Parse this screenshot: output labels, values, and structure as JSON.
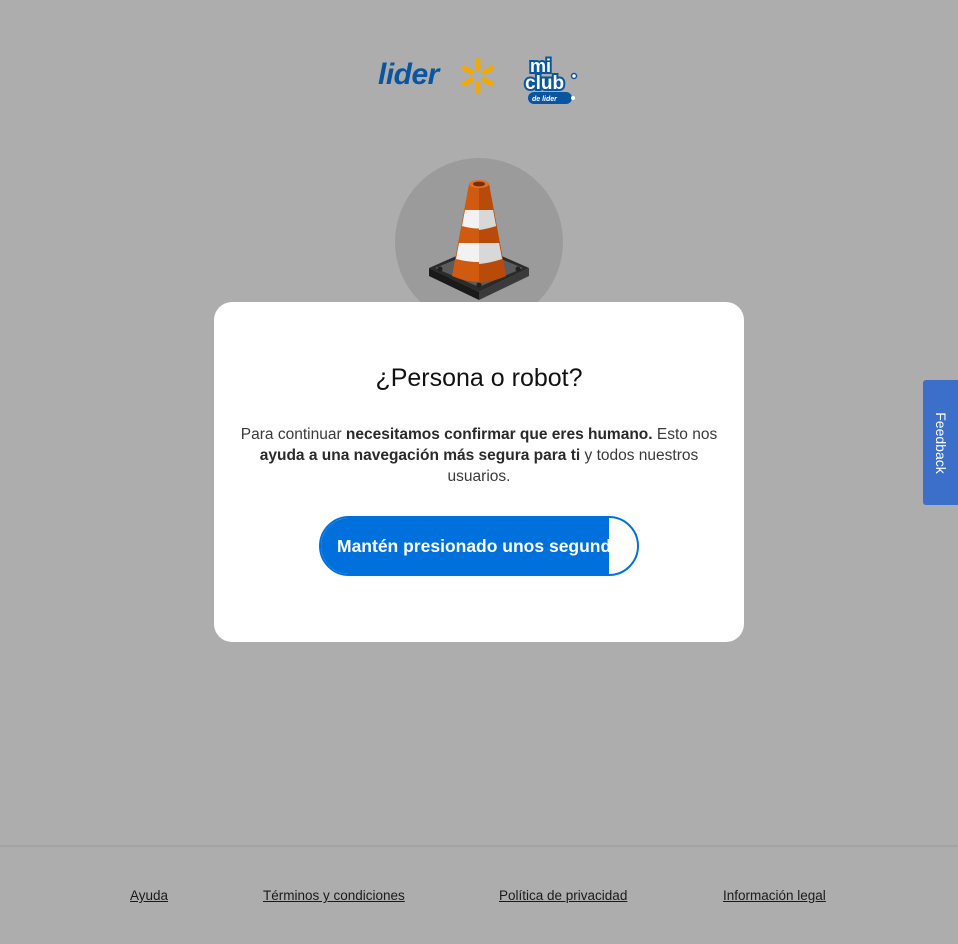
{
  "header": {
    "lider_logo_text": "lider",
    "miclub_logo": {
      "line1": "mi",
      "line2": "club",
      "line3": "de lider"
    },
    "brand_colors": {
      "lider_blue": "#0a55a0",
      "spark_yellow": "#f2a900"
    }
  },
  "illustration": {
    "icon": "traffic-cone-icon"
  },
  "modal": {
    "title": "¿Persona o robot?",
    "text_1": "Para continuar ",
    "text_bold_1": "necesitamos confirmar que eres humano.",
    "text_2": " Esto nos ",
    "text_bold_2": "ayuda a una navegación más segura para ti",
    "text_3": " y todos nuestros usuarios.",
    "hold_button": {
      "label": "Mantén presionado unos segundos",
      "progress": 0.91,
      "color": "#0071dc"
    }
  },
  "feedback": {
    "label": "Feedback",
    "color": "#3b6fc9"
  },
  "footer": {
    "links": [
      "Ayuda",
      "Términos y condiciones",
      "Política de privacidad",
      "Información legal"
    ]
  }
}
